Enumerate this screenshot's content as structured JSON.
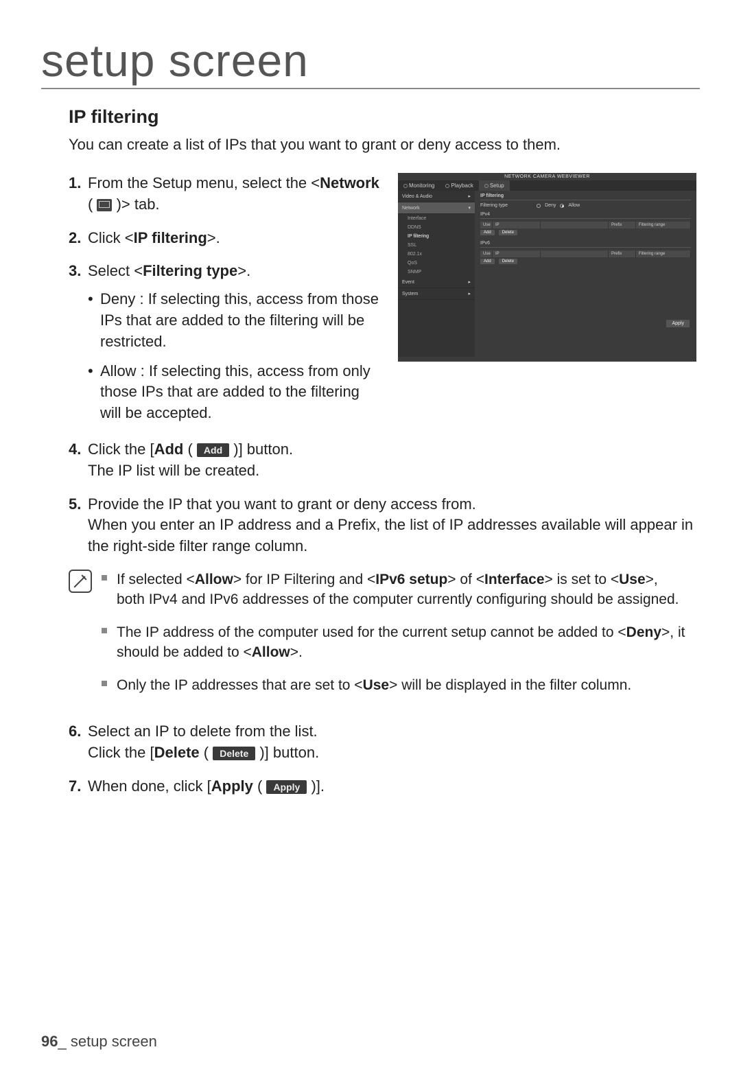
{
  "chapter_title": "setup screen",
  "section_heading": "IP filtering",
  "intro": "You can create a list of IPs that you want to grant or deny access to them.",
  "steps": {
    "s1_a": "From the Setup menu, select the <",
    "s1_net": "Network",
    "s1_b": " ( ",
    "s1_c": " )> tab.",
    "s2_a": "Click <",
    "s2_b": "IP filtering",
    "s2_c": ">.",
    "s3_a": "Select <",
    "s3_b": "Filtering type",
    "s3_c": ">.",
    "s3_sub1": "Deny : If selecting this, access from those IPs that are added to the filtering will be restricted.",
    "s3_sub2": "Allow : If selecting this, access from only those IPs that are added to the filtering will be accepted.",
    "s4_a": "Click the [",
    "s4_b": "Add",
    "s4_c": " ( ",
    "s4_btn": "Add",
    "s4_d": " )] button.",
    "s4_line2": "The IP list will be created.",
    "s5_line1": "Provide the IP that you want to grant or deny access from.",
    "s5_line2": "When you enter an IP address and a Prefix, the list of IP addresses available will appear in the right-side filter range column.",
    "s6_line1": "Select an IP to delete from the list.",
    "s6_a": "Click the [",
    "s6_b": "Delete",
    "s6_c": " ( ",
    "s6_btn": "Delete",
    "s6_d": " )] button.",
    "s7_a": "When done, click [",
    "s7_b": "Apply",
    "s7_c": " ( ",
    "s7_btn": "Apply",
    "s7_d": " )]."
  },
  "notes": {
    "n1_a": "If selected <",
    "n1_b": "Allow",
    "n1_c": "> for IP Filtering and <",
    "n1_d": "IPv6 setup",
    "n1_e": "> of <",
    "n1_f": "Interface",
    "n1_g": "> is set to <",
    "n1_h": "Use",
    "n1_i": ">, both IPv4 and IPv6 addresses of the computer currently configuring should be assigned.",
    "n2_a": "The IP address of the computer used for the current setup cannot be added to <",
    "n2_b": "Deny",
    "n2_c": ">, it should be added to <",
    "n2_d": "Allow",
    "n2_e": ">.",
    "n3_a": "Only the IP addresses that are set to <",
    "n3_b": "Use",
    "n3_c": "> will be displayed in the filter column."
  },
  "footer": {
    "page": "96",
    "sep": "_ ",
    "label": "setup screen"
  },
  "app": {
    "title": "NETWORK CAMERA WEBVIEWER",
    "tabs": {
      "monitoring": "Monitoring",
      "playback": "Playback",
      "setup": "Setup"
    },
    "side": {
      "g1": "Video & Audio",
      "g2": "Network",
      "g2a": "Interface",
      "g2b": "DDNS",
      "g2c": "IP filtering",
      "g2d": "SSL",
      "g2e": "802.1x",
      "g2f": "QoS",
      "g2g": "SNMP",
      "g3": "Event",
      "g4": "System"
    },
    "main": {
      "heading": "IP filtering",
      "ft_label": "Filtering type",
      "deny": "Deny",
      "allow": "Allow",
      "ipv4": "IPv4",
      "ipv6": "IPv6",
      "col_use": "Use",
      "col_ip": "IP",
      "col_prefix": "Prefix",
      "col_range": "Filtering range",
      "add": "Add",
      "delete": "Delete",
      "apply": "Apply"
    }
  }
}
